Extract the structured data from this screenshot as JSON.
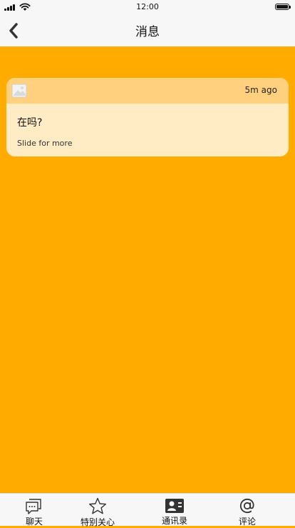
{
  "status_bar": {
    "time": "12:00"
  },
  "nav": {
    "title": "消息"
  },
  "notification": {
    "time": "5m ago",
    "message": "在吗?",
    "hint": "Slide for more"
  },
  "tabs": [
    {
      "label": "聊天",
      "icon": "chat-icon"
    },
    {
      "label": "特别关心",
      "icon": "star-icon"
    },
    {
      "label": "通讯录",
      "icon": "contacts-icon"
    },
    {
      "label": "评论",
      "icon": "at-icon"
    }
  ],
  "colors": {
    "background": "#FFAB00",
    "card_header": "#FFD17F",
    "card_body": "#FFEBC4",
    "bars": "#F7F7F7"
  }
}
